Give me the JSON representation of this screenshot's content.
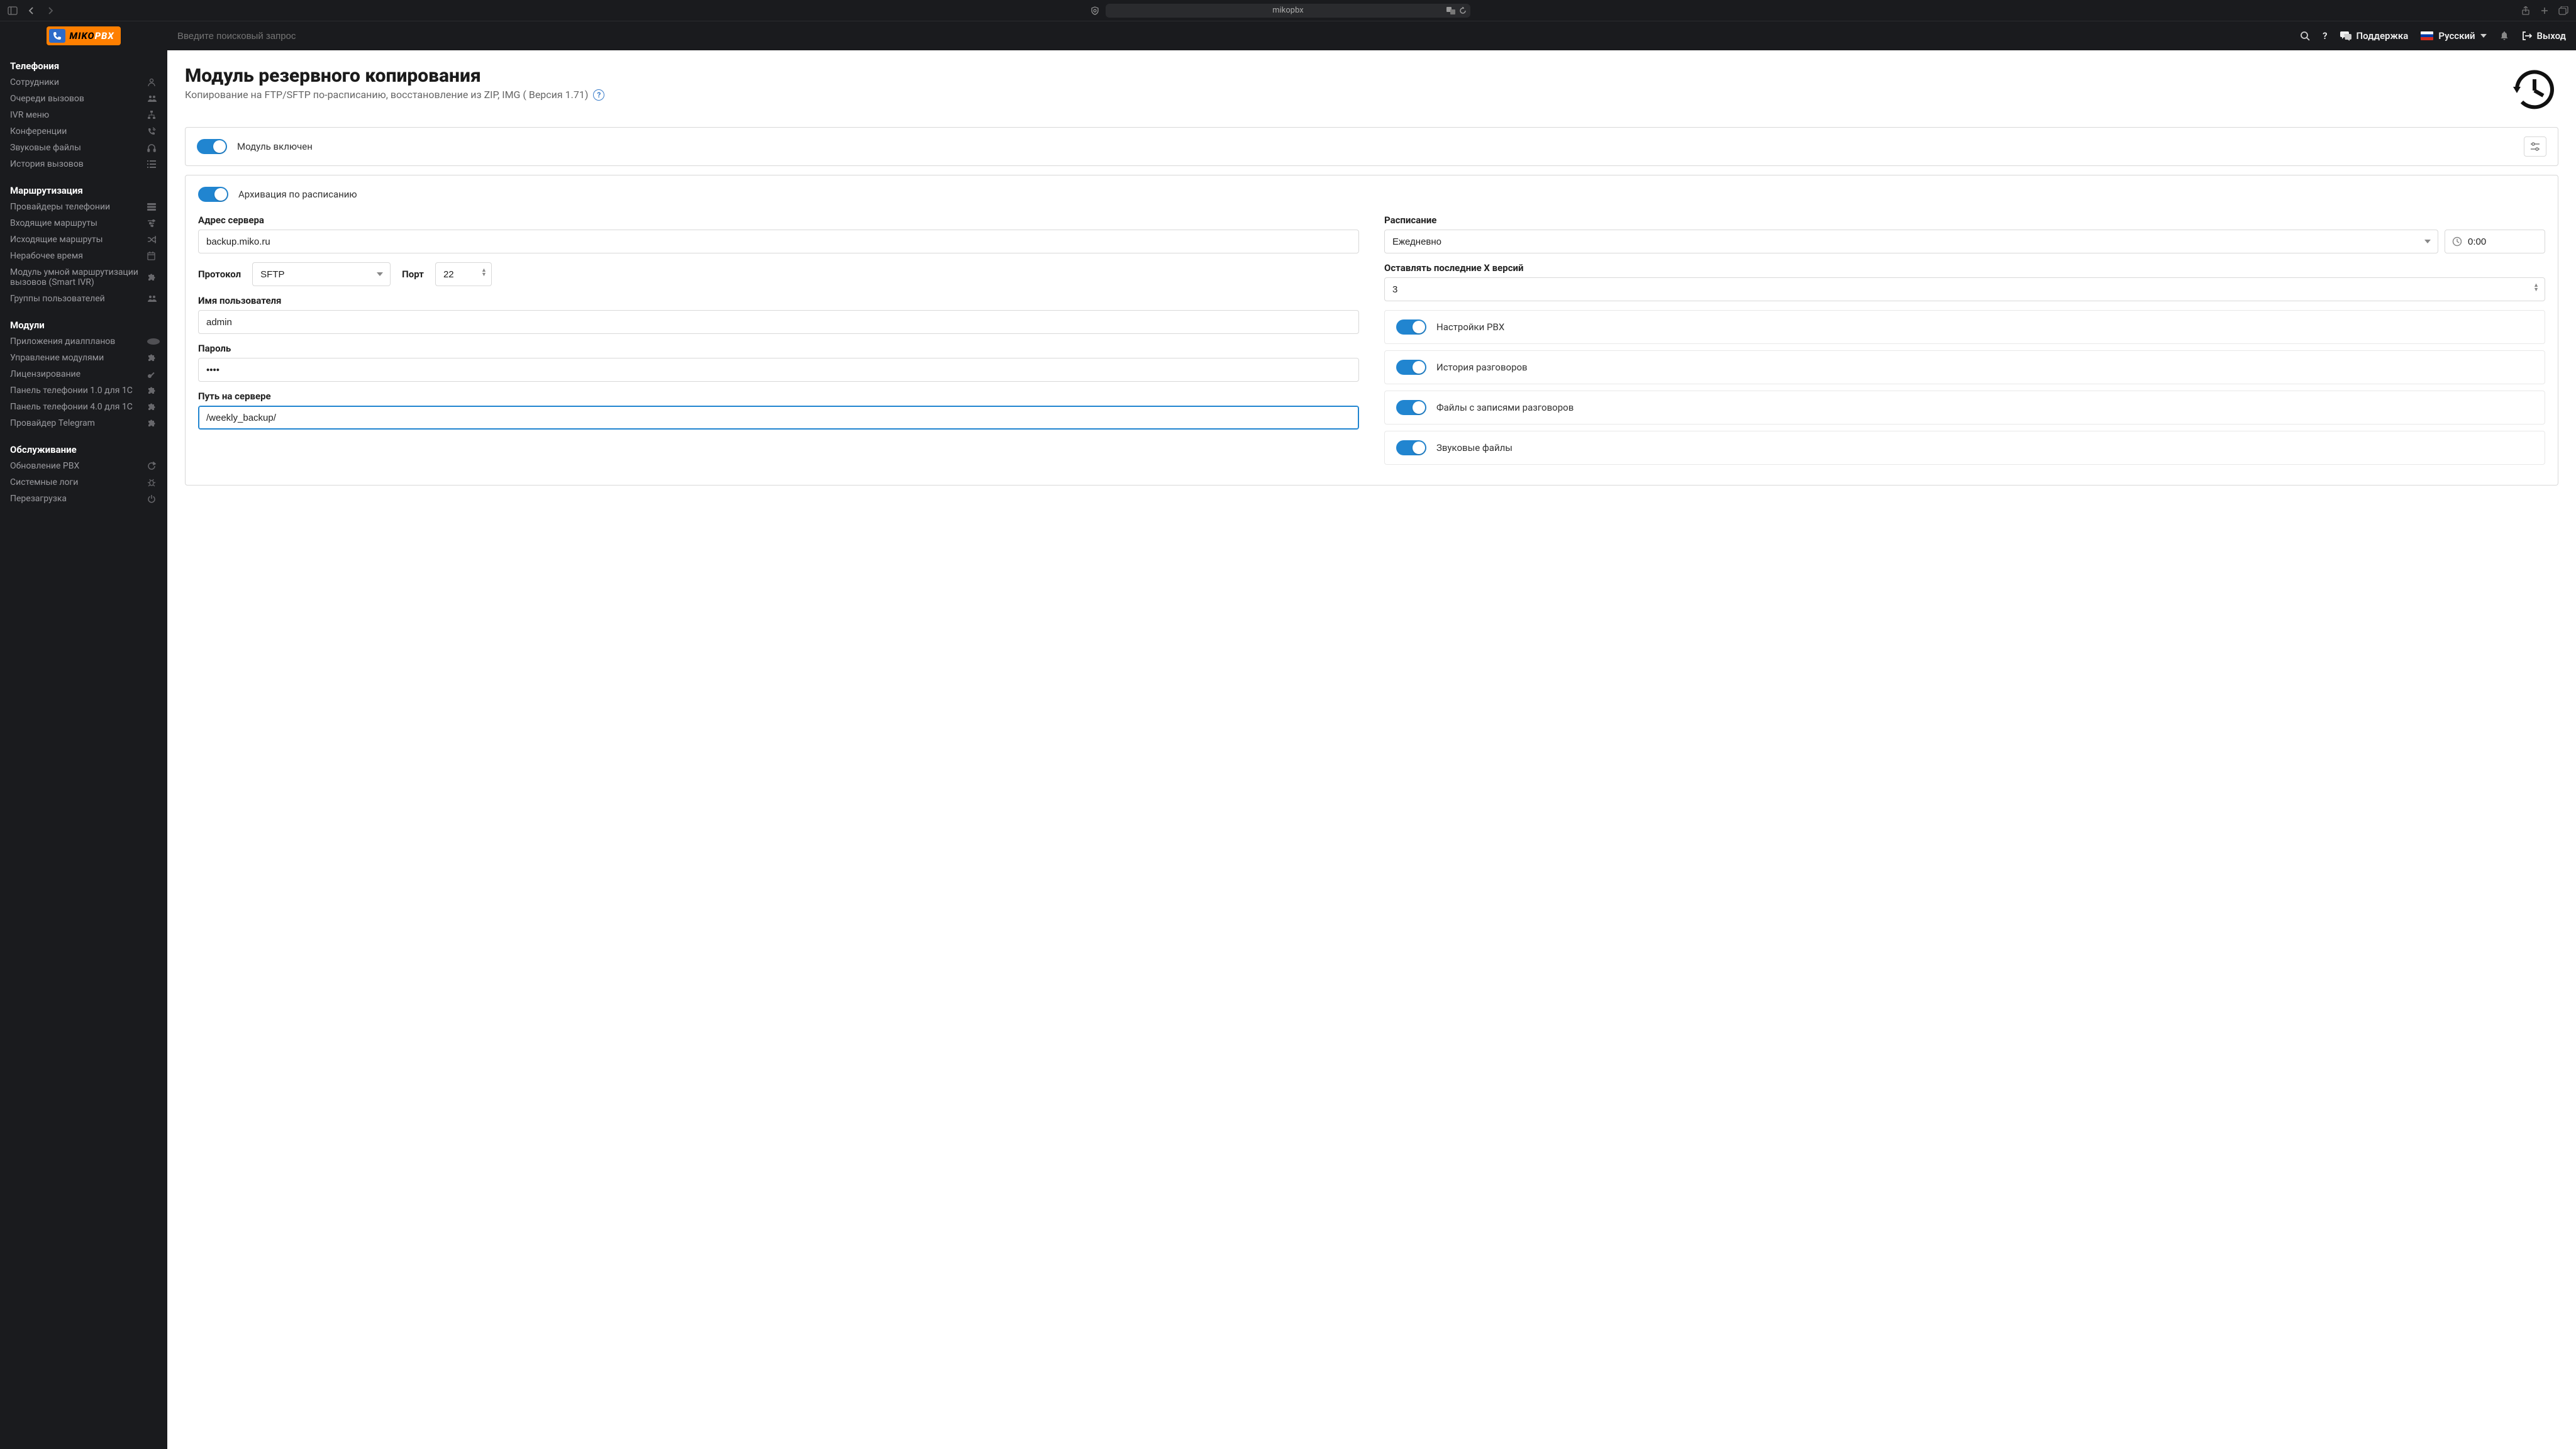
{
  "browser": {
    "url": "mikopbx"
  },
  "logo": {
    "name": "MIKO",
    "suffix": "PBX"
  },
  "topbar": {
    "search_placeholder": "Введите поисковый запрос",
    "support": "Поддержка",
    "language": "Русский",
    "logout": "Выход"
  },
  "sidebar": {
    "sections": [
      {
        "heading": "Телефония",
        "items": [
          {
            "label": "Сотрудники",
            "icon": "user"
          },
          {
            "label": "Очереди вызовов",
            "icon": "users"
          },
          {
            "label": "IVR меню",
            "icon": "sitemap"
          },
          {
            "label": "Конференции",
            "icon": "phone"
          },
          {
            "label": "Звуковые файлы",
            "icon": "headphones"
          },
          {
            "label": "История вызовов",
            "icon": "list"
          }
        ]
      },
      {
        "heading": "Маршрутизация",
        "items": [
          {
            "label": "Провайдеры телефонии",
            "icon": "server"
          },
          {
            "label": "Входящие маршруты",
            "icon": "filter"
          },
          {
            "label": "Исходящие маршруты",
            "icon": "random"
          },
          {
            "label": "Нерабочее время",
            "icon": "calendar"
          },
          {
            "label": "Модуль умной маршрутизации вызовов (Smart IVR)",
            "icon": "puzzle"
          },
          {
            "label": "Группы пользователей",
            "icon": "users"
          }
        ]
      },
      {
        "heading": "Модули",
        "items": [
          {
            "label": "Приложения диалпланов",
            "icon": "php"
          },
          {
            "label": "Управление модулями",
            "icon": "puzzle"
          },
          {
            "label": "Лицензирование",
            "icon": "key"
          },
          {
            "label": "Панель телефонии 1.0 для 1С",
            "icon": "puzzle"
          },
          {
            "label": "Панель телефонии 4.0 для 1С",
            "icon": "puzzle"
          },
          {
            "label": "Провайдер Telegram",
            "icon": "puzzle"
          }
        ]
      },
      {
        "heading": "Обслуживание",
        "items": [
          {
            "label": "Обновление PBX",
            "icon": "refresh"
          },
          {
            "label": "Системные логи",
            "icon": "bug"
          },
          {
            "label": "Перезагрузка",
            "icon": "power"
          }
        ]
      }
    ]
  },
  "page": {
    "title": "Модуль резервного копирования",
    "subtitle": "Копирование на FTP/SFTP по-расписанию, восстановление из ZIP, IMG ( Версия 1.71)",
    "enabled_label": "Модуль включен",
    "schedule_enabled_label": "Архивация по расписанию"
  },
  "form": {
    "left": {
      "server_address_label": "Адрес сервера",
      "server_address": "backup.miko.ru",
      "protocol_label": "Протокол",
      "protocol": "SFTP",
      "port_label": "Порт",
      "port": "22",
      "username_label": "Имя пользователя",
      "username": "admin",
      "password_label": "Пароль",
      "password": "••••",
      "path_label": "Путь на сервере",
      "path": "/weekly_backup/"
    },
    "right": {
      "schedule_label": "Расписание",
      "schedule_value": "Ежедневно",
      "time": "0:00",
      "keep_versions_label": "Оставлять последние X версий",
      "keep_versions": "3",
      "options": [
        "Настройки PBX",
        "История разговоров",
        "Файлы с записями разговоров",
        "Звуковые файлы"
      ]
    }
  }
}
